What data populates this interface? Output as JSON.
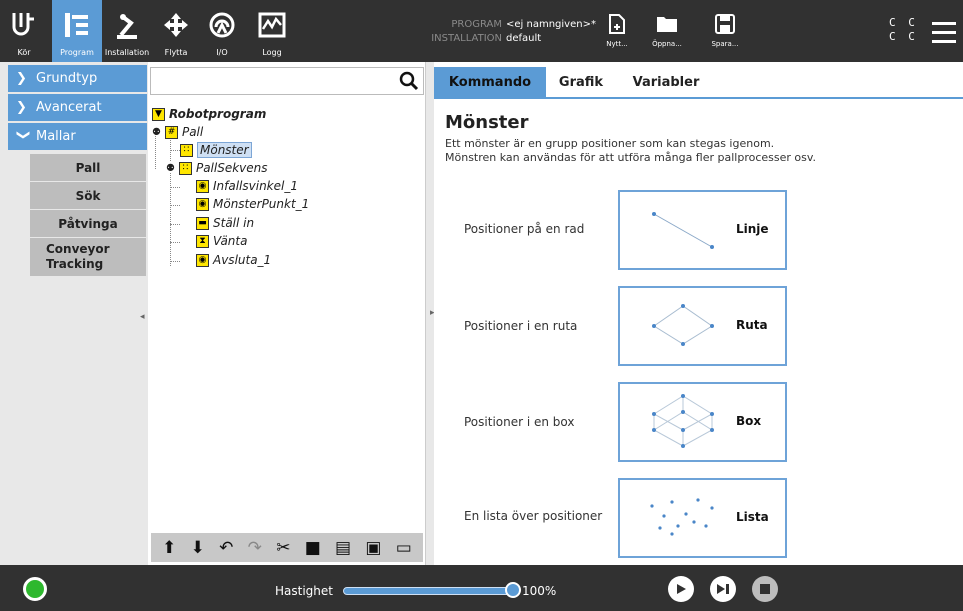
{
  "header": {
    "nav": [
      {
        "label": "Kör",
        "icon": "ur-logo-icon"
      },
      {
        "label": "Program",
        "icon": "program-icon",
        "active": true
      },
      {
        "label": "Installation",
        "icon": "installation-icon"
      },
      {
        "label": "Flytta",
        "icon": "move-icon"
      },
      {
        "label": "I/O",
        "icon": "io-icon"
      },
      {
        "label": "Logg",
        "icon": "log-icon"
      }
    ],
    "program_key": "PROGRAM",
    "program_value": "<ej namngiven>*",
    "installation_key": "INSTALLATION",
    "installation_value": "default",
    "file_buttons": [
      {
        "label": "Nytt...",
        "icon": "new-file-icon"
      },
      {
        "label": "Öppna...",
        "icon": "folder-icon"
      },
      {
        "label": "Spara...",
        "icon": "save-icon"
      }
    ],
    "cc_line1": "C C",
    "cc_line2": "C C"
  },
  "leftmenu": {
    "items": [
      {
        "label": "Grundtyp",
        "chevron": ">"
      },
      {
        "label": "Avancerat",
        "chevron": ">"
      },
      {
        "label": "Mallar",
        "chevron": "v"
      }
    ],
    "subitems": [
      "Pall",
      "Sök",
      "Påtvinga",
      "Conveyor Tracking"
    ]
  },
  "tree": {
    "search_placeholder": "",
    "nodes": [
      {
        "label": "Robotprogram",
        "icon": "collapse-icon"
      },
      {
        "label": "Pall",
        "icon": "pallet-icon"
      },
      {
        "label": "Mönster",
        "icon": "pattern-icon",
        "selected": true
      },
      {
        "label": "PallSekvens",
        "icon": "pattern-icon"
      },
      {
        "label": "Infallsvinkel_1",
        "icon": "waypoint-icon"
      },
      {
        "label": "MönsterPunkt_1",
        "icon": "waypoint-icon"
      },
      {
        "label": "Ställ in",
        "icon": "set-icon"
      },
      {
        "label": "Vänta",
        "icon": "wait-icon"
      },
      {
        "label": "Avsluta_1",
        "icon": "waypoint-icon"
      }
    ]
  },
  "tabs": [
    "Kommando",
    "Grafik",
    "Variabler"
  ],
  "content": {
    "title": "Mönster",
    "desc1": "Ett mönster är en grupp positioner som kan stegas igenom.",
    "desc2": "Mönstren kan användas för att utföra många fler pallprocesser osv.",
    "patterns": [
      {
        "label": "Positioner på en rad",
        "name": "Linje"
      },
      {
        "label": "Positioner i en ruta",
        "name": "Ruta"
      },
      {
        "label": "Positioner i en box",
        "name": "Box"
      },
      {
        "label": "En lista över positioner",
        "name": "Lista"
      }
    ]
  },
  "footer": {
    "speed_label": "Hastighet",
    "speed_value": "100%",
    "speed_fraction": 1.0
  },
  "colors": {
    "accent": "#5b9bd5",
    "header": "#313131",
    "node_yellow": "#ffe600",
    "power_green": "#2eb82e"
  }
}
